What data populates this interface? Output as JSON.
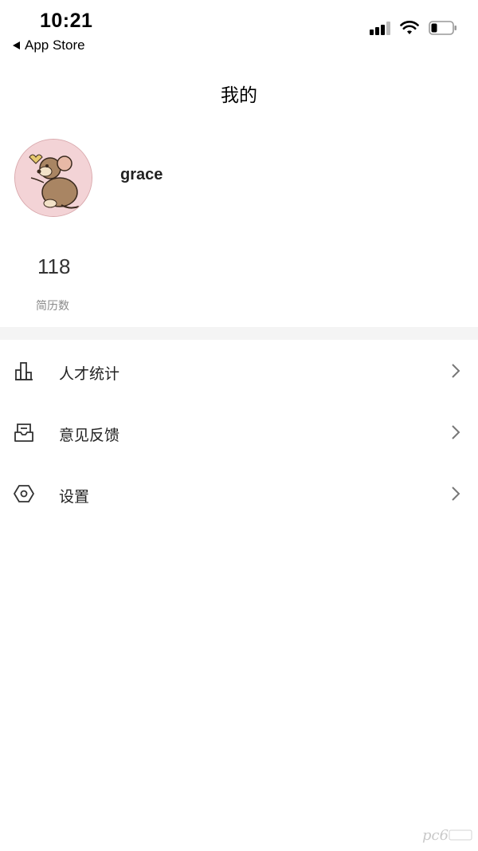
{
  "status_bar": {
    "time": "10:21",
    "back_app_label": "App Store",
    "icons": [
      "cellular-signal-icon",
      "wifi-icon",
      "battery-icon"
    ]
  },
  "header": {
    "title": "我的"
  },
  "profile": {
    "username": "grace",
    "avatar": "avatar-image"
  },
  "stats": {
    "value": "118",
    "label": "简历数"
  },
  "menu": {
    "items": [
      {
        "label": "人才统计",
        "icon": "bar-chart-icon"
      },
      {
        "label": "意见反馈",
        "icon": "feedback-inbox-icon"
      },
      {
        "label": "设置",
        "icon": "settings-hexagon-icon"
      }
    ]
  },
  "colors": {
    "background": "#ffffff",
    "divider": "#f4f4f4",
    "text_primary": "#222222",
    "text_secondary": "#8a8a8a",
    "chevron": "#777777"
  }
}
